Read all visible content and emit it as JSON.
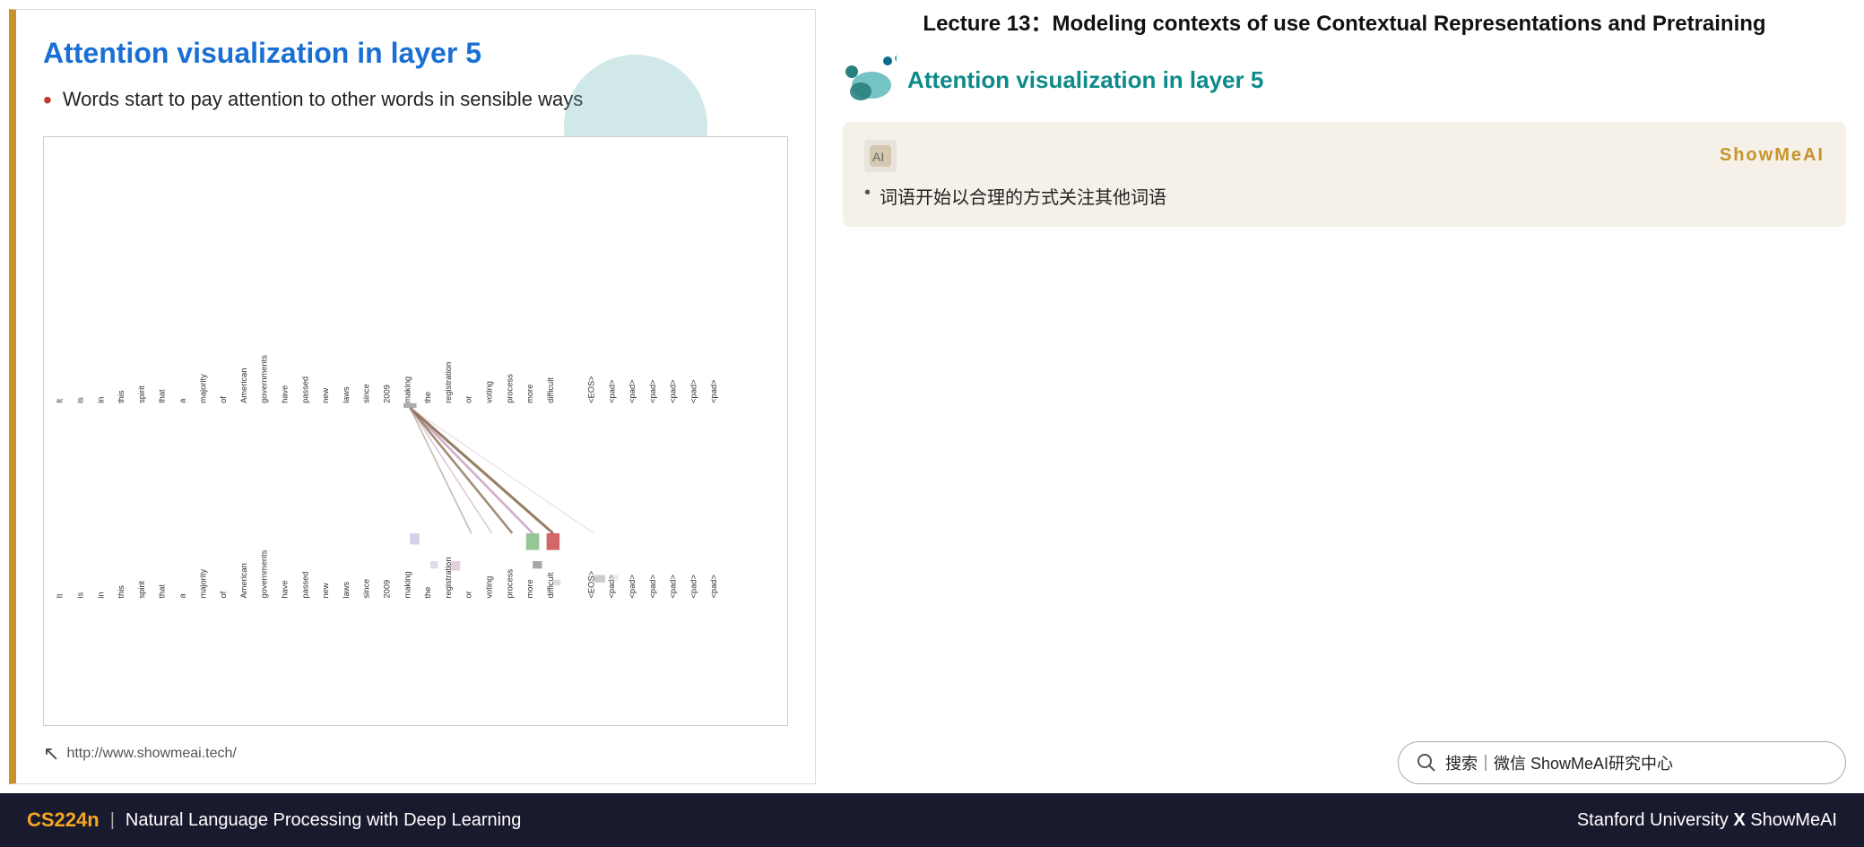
{
  "slide": {
    "title": "Attention visualization in layer 5",
    "bullet": "Words start to pay attention to other words in sensible ways",
    "url": "http://www.showmeai.tech/",
    "border_color": "#c8932a"
  },
  "right_panel": {
    "lecture_title": "Lecture 13：Modeling contexts of use Contextual Representations and Pretraining",
    "section_title": "Attention visualization in layer 5",
    "showmeai_card": {
      "brand": "ShowMeAI",
      "chinese_bullet": "词语开始以合理的方式关注其他词语"
    },
    "search_placeholder": "搜索｜微信 ShowMeAI研究中心"
  },
  "bottom_bar": {
    "course_code": "CS224n",
    "separator": "|",
    "course_name": "Natural Language Processing with Deep Learning",
    "university": "Stanford University",
    "x_mark": "X",
    "brand": "ShowMeAI"
  },
  "words_top": [
    "It",
    "is",
    "in",
    "this",
    "spirit",
    "that",
    "a",
    "majority",
    "of",
    "American",
    "governments",
    "have",
    "passed",
    "new",
    "laws",
    "since",
    "2009",
    "making",
    "the",
    "registration",
    "or",
    "voting",
    "process",
    "more",
    "difficult",
    "",
    "<EOS>",
    "<pad>",
    "<pad>",
    "<pad>",
    "<pad>",
    "<pad>",
    "<pad>"
  ],
  "words_bottom": [
    "It",
    "is",
    "in",
    "this",
    "spirit",
    "that",
    "a",
    "majority",
    "of",
    "American",
    "governments",
    "have",
    "passed",
    "new",
    "laws",
    "since",
    "2009",
    "making",
    "the",
    "registration",
    "or",
    "voting",
    "process",
    "more",
    "difficult",
    "",
    "<EOS>",
    "<pad>",
    "<pad>",
    "<pad>",
    "<pad>",
    "<pad>",
    "<pad>"
  ]
}
